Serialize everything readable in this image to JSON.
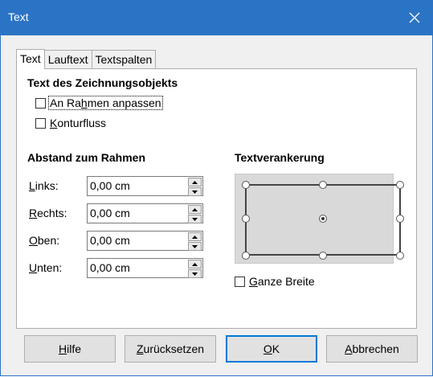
{
  "window": {
    "title": "Text"
  },
  "tabs": [
    {
      "label": "Text"
    },
    {
      "label": "Lauftext"
    },
    {
      "label": "Textspalten"
    }
  ],
  "section_object": {
    "heading": "Text des Zeichnungsobjekts",
    "fit_frame": {
      "pre": "An Ra",
      "ul": "h",
      "post": "men anpassen",
      "checked": false
    },
    "contour": {
      "pre": "",
      "ul": "K",
      "post": "onturfluss",
      "checked": false
    }
  },
  "section_spacing": {
    "heading": "Abstand zum Rahmen",
    "rows": [
      {
        "pre": "",
        "ul": "L",
        "post": "inks:",
        "value": "0,00 cm"
      },
      {
        "pre": "",
        "ul": "R",
        "post": "echts:",
        "value": "0,00 cm"
      },
      {
        "pre": "",
        "ul": "O",
        "post": "ben:",
        "value": "0,00 cm"
      },
      {
        "pre": "",
        "ul": "U",
        "post": "nten:",
        "value": "0,00 cm"
      }
    ]
  },
  "section_anchor": {
    "heading": "Textverankerung",
    "selected": "center",
    "full_width": {
      "pre": "",
      "ul": "G",
      "post": "anze Breite",
      "checked": false
    }
  },
  "buttons": {
    "help": {
      "pre": "",
      "ul": "H",
      "post": "ilfe"
    },
    "reset": {
      "pre": "",
      "ul": "Z",
      "post": "urücksetzen"
    },
    "ok": {
      "pre": "",
      "ul": "O",
      "post": "K"
    },
    "cancel": {
      "pre": "",
      "ul": "A",
      "post": "bbrechen"
    }
  },
  "colors": {
    "titlebar": "#2b73c4",
    "dialog_bg": "#f0f0f0",
    "default_button_border": "#0078d7"
  }
}
